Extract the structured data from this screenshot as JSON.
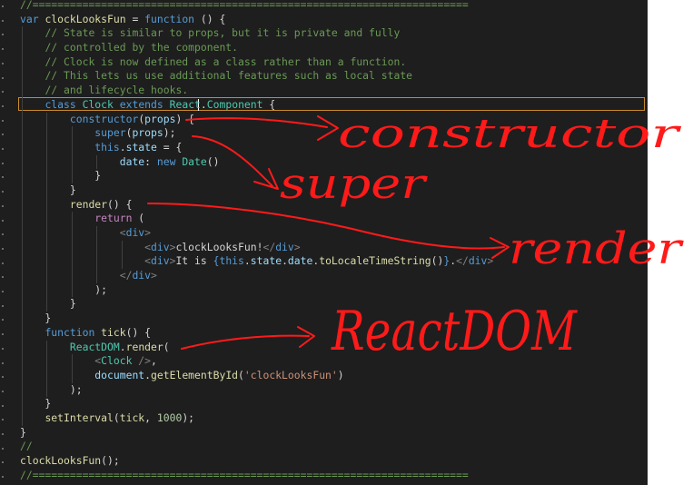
{
  "code_lines": [
    [
      [
        "c",
        "//======================================================================"
      ]
    ],
    [
      [
        "k",
        "var "
      ],
      [
        "f",
        "clockLooksFun"
      ],
      [
        "p",
        " = "
      ],
      [
        "k",
        "function"
      ],
      [
        "p",
        " () {"
      ]
    ],
    [
      [
        "p",
        "    "
      ],
      [
        "c",
        "// State is similar to props, but it is private and fully"
      ]
    ],
    [
      [
        "p",
        "    "
      ],
      [
        "c",
        "// controlled by the component."
      ]
    ],
    [
      [
        "p",
        "    "
      ],
      [
        "c",
        "// Clock is now defined as a class rather than a function."
      ]
    ],
    [
      [
        "p",
        "    "
      ],
      [
        "c",
        "// This lets us use additional features such as local state"
      ]
    ],
    [
      [
        "p",
        "    "
      ],
      [
        "c",
        "// and lifecycle hooks."
      ]
    ],
    [
      [
        "p",
        "    "
      ],
      [
        "k",
        "class "
      ],
      [
        "t",
        "Clock "
      ],
      [
        "k",
        "extends "
      ],
      [
        "t",
        "React"
      ],
      [
        "p",
        "."
      ],
      [
        "t",
        "Component"
      ],
      [
        "p",
        " {"
      ]
    ],
    [
      [
        "p",
        "        "
      ],
      [
        "k",
        "constructor"
      ],
      [
        "p",
        "("
      ],
      [
        "v",
        "props"
      ],
      [
        "p",
        ") {"
      ]
    ],
    [
      [
        "p",
        "            "
      ],
      [
        "k",
        "super"
      ],
      [
        "p",
        "("
      ],
      [
        "v",
        "props"
      ],
      [
        "p",
        ");"
      ]
    ],
    [
      [
        "p",
        "            "
      ],
      [
        "k",
        "this"
      ],
      [
        "p",
        "."
      ],
      [
        "v",
        "state"
      ],
      [
        "p",
        " = {"
      ]
    ],
    [
      [
        "p",
        "                "
      ],
      [
        "v",
        "date"
      ],
      [
        "p",
        ": "
      ],
      [
        "k",
        "new "
      ],
      [
        "t",
        "Date"
      ],
      [
        "p",
        "()"
      ]
    ],
    [
      [
        "p",
        "            }"
      ]
    ],
    [
      [
        "p",
        "        }"
      ]
    ],
    [
      [
        "p",
        "        "
      ],
      [
        "f",
        "render"
      ],
      [
        "p",
        "() {"
      ]
    ],
    [
      [
        "p",
        "            "
      ],
      [
        "kc",
        "return"
      ],
      [
        "p",
        " ("
      ]
    ],
    [
      [
        "p",
        "                "
      ],
      [
        "tg",
        "<"
      ],
      [
        "tn",
        "div"
      ],
      [
        "tg",
        ">"
      ]
    ],
    [
      [
        "p",
        "                    "
      ],
      [
        "tg",
        "<"
      ],
      [
        "tn",
        "div"
      ],
      [
        "tg",
        ">"
      ],
      [
        "p",
        "clockLooksFun!"
      ],
      [
        "tg",
        "</"
      ],
      [
        "tn",
        "div"
      ],
      [
        "tg",
        ">"
      ]
    ],
    [
      [
        "p",
        "                    "
      ],
      [
        "tg",
        "<"
      ],
      [
        "tn",
        "div"
      ],
      [
        "tg",
        ">"
      ],
      [
        "p",
        "It is "
      ],
      [
        "k",
        "{"
      ],
      [
        "k",
        "this"
      ],
      [
        "p",
        "."
      ],
      [
        "v",
        "state"
      ],
      [
        "p",
        "."
      ],
      [
        "v",
        "date"
      ],
      [
        "p",
        "."
      ],
      [
        "f",
        "toLocaleTimeString"
      ],
      [
        "p",
        "()"
      ],
      [
        "k",
        "}"
      ],
      [
        "p",
        "."
      ],
      [
        "tg",
        "</"
      ],
      [
        "tn",
        "div"
      ],
      [
        "tg",
        ">"
      ]
    ],
    [
      [
        "p",
        "                "
      ],
      [
        "tg",
        "</"
      ],
      [
        "tn",
        "div"
      ],
      [
        "tg",
        ">"
      ]
    ],
    [
      [
        "p",
        "            );"
      ]
    ],
    [
      [
        "p",
        "        }"
      ]
    ],
    [
      [
        "p",
        "    }"
      ]
    ],
    [
      [
        "p",
        "    "
      ],
      [
        "k",
        "function "
      ],
      [
        "f",
        "tick"
      ],
      [
        "p",
        "() {"
      ]
    ],
    [
      [
        "p",
        "        "
      ],
      [
        "t",
        "ReactDOM"
      ],
      [
        "p",
        "."
      ],
      [
        "f",
        "render"
      ],
      [
        "p",
        "("
      ]
    ],
    [
      [
        "p",
        "            "
      ],
      [
        "tg",
        "<"
      ],
      [
        "t",
        "Clock"
      ],
      [
        "tg",
        " />"
      ],
      [
        "p",
        ","
      ]
    ],
    [
      [
        "p",
        "            "
      ],
      [
        "v",
        "document"
      ],
      [
        "p",
        "."
      ],
      [
        "f",
        "getElementById"
      ],
      [
        "p",
        "("
      ],
      [
        "s",
        "'clockLooksFun'"
      ],
      [
        "p",
        ")"
      ]
    ],
    [
      [
        "p",
        "        );"
      ]
    ],
    [
      [
        "p",
        "    }"
      ]
    ],
    [
      [
        "p",
        "    "
      ],
      [
        "f",
        "setInterval"
      ],
      [
        "p",
        "("
      ],
      [
        "f",
        "tick"
      ],
      [
        "p",
        ", "
      ],
      [
        "n",
        "1000"
      ],
      [
        "p",
        ");"
      ]
    ],
    [
      [
        "p",
        "}"
      ]
    ],
    [
      [
        "c",
        "//"
      ]
    ],
    [
      [
        "f",
        "clockLooksFun"
      ],
      [
        "p",
        "();"
      ]
    ],
    [
      [
        "c",
        "//======================================================================"
      ]
    ]
  ],
  "annotations": {
    "constructor": "constructor",
    "super": "super",
    "render": "render",
    "reactdom": "ReactDOM"
  },
  "colors": {
    "editor_bg": "#1e1e1e",
    "annotation": "#ff1a1a",
    "highlight_border": "#c98a2c"
  }
}
